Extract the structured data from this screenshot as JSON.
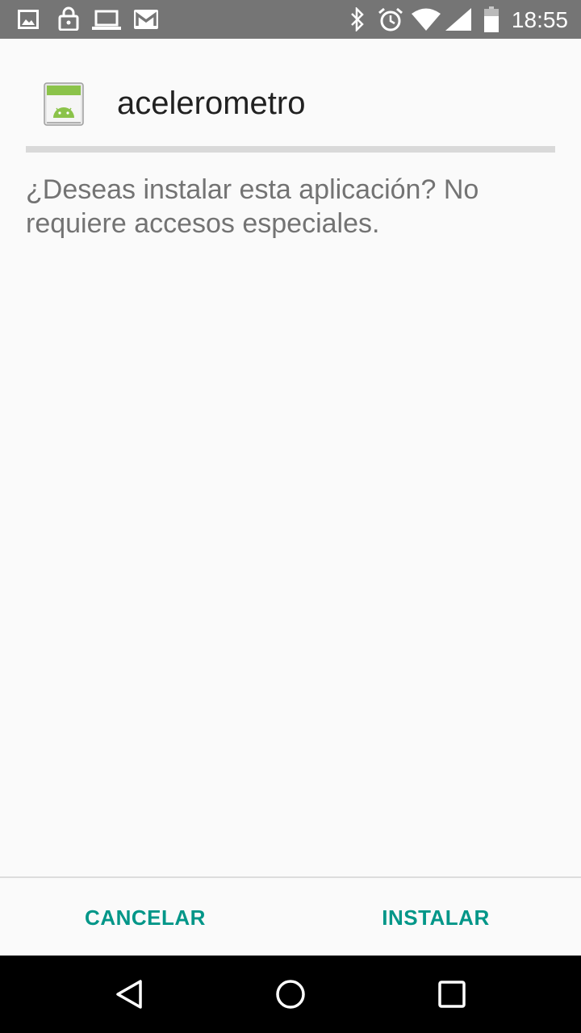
{
  "status_bar": {
    "time": "18:55",
    "left_icons": [
      "image-icon",
      "lock-icon",
      "laptop-icon",
      "gmail-icon"
    ],
    "right_icons": [
      "bluetooth-icon",
      "alarm-icon",
      "wifi-icon",
      "signal-icon",
      "battery-icon"
    ]
  },
  "app": {
    "name": "acelerometro",
    "icon": "android-app-icon"
  },
  "message": "¿Deseas instalar esta aplicación? No requiere accesos especiales.",
  "buttons": {
    "cancel": "CANCELAR",
    "install": "INSTALAR"
  },
  "navigation": [
    "back-icon",
    "home-icon",
    "recents-icon"
  ],
  "colors": {
    "status_bar": "#757575",
    "accent": "#009688",
    "background": "#fafafa"
  }
}
